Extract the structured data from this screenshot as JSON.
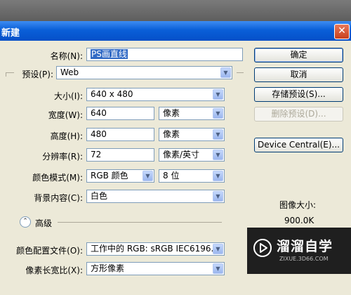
{
  "window": {
    "title": "新建"
  },
  "form": {
    "name_label": "名称(N):",
    "name_value": "PS画直线",
    "preset_label": "预设(P):",
    "preset_value": "Web",
    "size_label": "大小(I):",
    "size_value": "640 x 480",
    "width_label": "宽度(W):",
    "width_value": "640",
    "width_unit": "像素",
    "height_label": "高度(H):",
    "height_value": "480",
    "height_unit": "像素",
    "resolution_label": "分辨率(R):",
    "resolution_value": "72",
    "resolution_unit": "像素/英寸",
    "color_mode_label": "颜色模式(M):",
    "color_mode_value": "RGB 颜色",
    "bit_depth_value": "8 位",
    "background_label": "背景内容(C):",
    "background_value": "白色",
    "advanced_label": "高级",
    "color_profile_label": "颜色配置文件(O):",
    "color_profile_value": "工作中的 RGB: sRGB IEC6196...",
    "pixel_aspect_label": "像素长宽比(X):",
    "pixel_aspect_value": "方形像素"
  },
  "buttons": {
    "ok": "确定",
    "cancel": "取消",
    "save_preset": "存储预设(S)...",
    "delete_preset": "删除预设(D)...",
    "device_central": "Device Central(E)..."
  },
  "info": {
    "image_size_label": "图像大小:",
    "image_size_value": "900.0K"
  },
  "watermark": {
    "brand": "溜溜自学",
    "url": "ZIXUE.3D66.COM"
  },
  "colors": {
    "titlebar": "#0a5fd8",
    "dialog_bg": "#ece9d8",
    "selection": "#316ac5"
  }
}
